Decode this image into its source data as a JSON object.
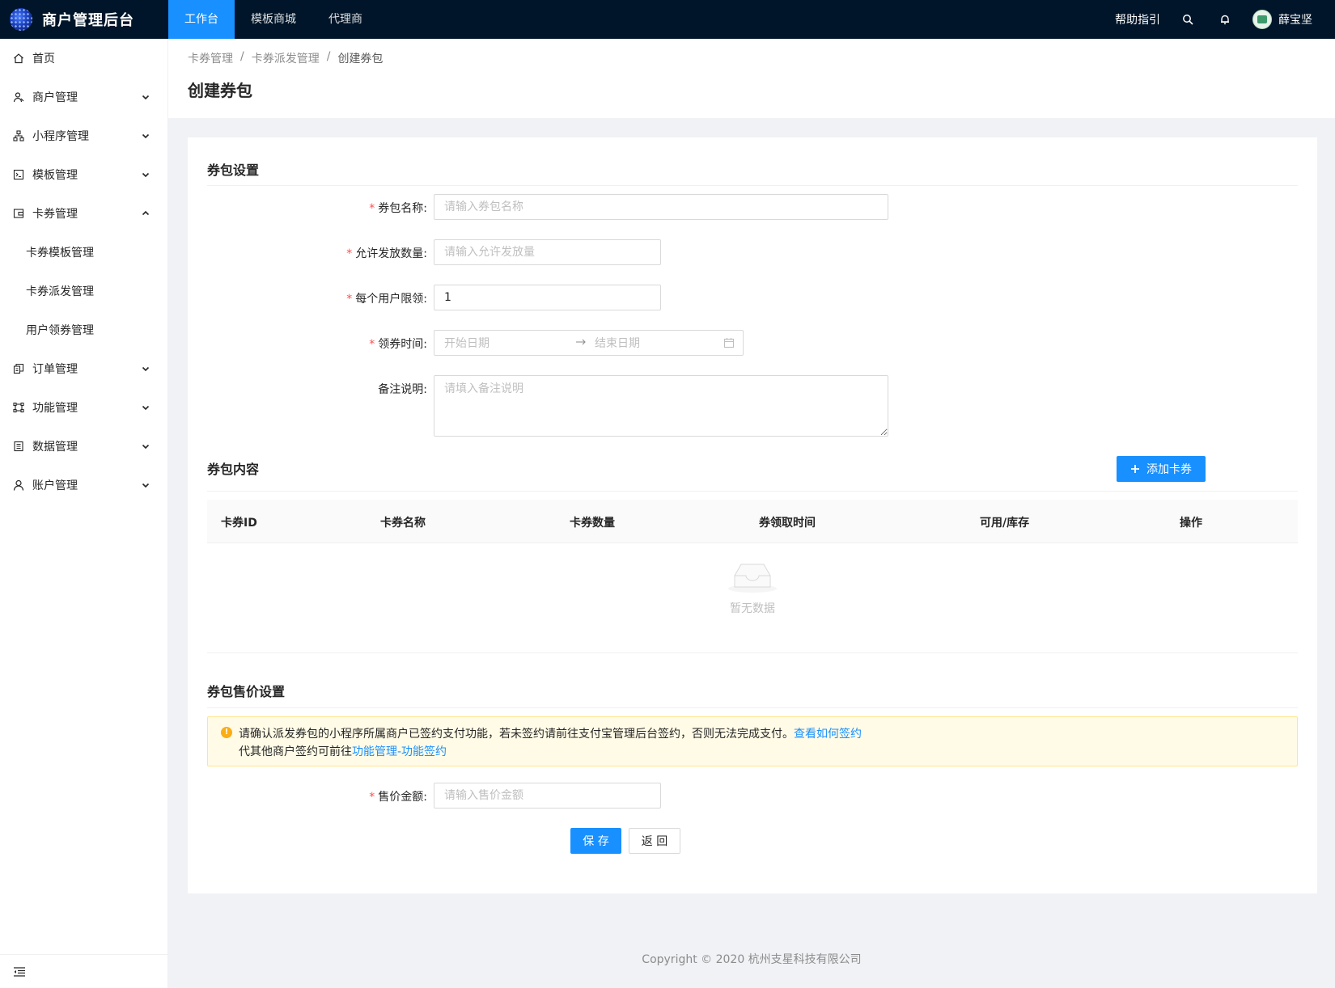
{
  "app": {
    "title": "商户管理后台"
  },
  "topnav": [
    {
      "label": "工作台",
      "active": true
    },
    {
      "label": "模板商城",
      "active": false
    },
    {
      "label": "代理商",
      "active": false
    }
  ],
  "header_right": {
    "help": "帮助指引",
    "username": "薛宝坚"
  },
  "sidebar": {
    "items": [
      {
        "label": "首页",
        "icon": "home-icon"
      },
      {
        "label": "商户管理",
        "icon": "merchant-icon",
        "expandable": true
      },
      {
        "label": "小程序管理",
        "icon": "miniprogram-icon",
        "expandable": true
      },
      {
        "label": "模板管理",
        "icon": "template-icon",
        "expandable": true
      },
      {
        "label": "卡券管理",
        "icon": "wallet-icon",
        "expanded": true
      },
      {
        "label": "订单管理",
        "icon": "order-icon",
        "expandable": true
      },
      {
        "label": "功能管理",
        "icon": "function-icon",
        "expandable": true
      },
      {
        "label": "数据管理",
        "icon": "data-icon",
        "expandable": true
      },
      {
        "label": "账户管理",
        "icon": "user-icon",
        "expandable": true
      }
    ],
    "subitems": [
      {
        "label": "卡券模板管理"
      },
      {
        "label": "卡券派发管理"
      },
      {
        "label": "用户领券管理"
      }
    ]
  },
  "breadcrumb": [
    "卡券管理",
    "卡券派发管理",
    "创建券包"
  ],
  "page_title": "创建券包",
  "sections": {
    "settings": "券包设置",
    "content": "券包内容",
    "price": "券包售价设置"
  },
  "form": {
    "name": {
      "label": "券包名称:",
      "placeholder": "请输入券包名称",
      "required": true
    },
    "quantity": {
      "label": "允许发放数量:",
      "placeholder": "请输入允许发放量",
      "required": true
    },
    "limit": {
      "label": "每个用户限领:",
      "value": "1",
      "required": true
    },
    "time": {
      "label": "领券时间:",
      "start_placeholder": "开始日期",
      "end_placeholder": "结束日期",
      "required": true
    },
    "remark": {
      "label": "备注说明:",
      "placeholder": "请填入备注说明"
    },
    "price": {
      "label": "售价金额:",
      "placeholder": "请输入售价金额",
      "required": true
    }
  },
  "add_coupon_button": "添加卡券",
  "table": {
    "columns": [
      "卡券ID",
      "卡券名称",
      "卡券数量",
      "券领取时间",
      "可用/库存",
      "操作"
    ],
    "rows": [],
    "empty_text": "暂无数据"
  },
  "alert": {
    "line1": "请确认派发券包的小程序所属商户已签约支付功能，若未签约请前往支付宝管理后台签约，否则无法完成支付。",
    "line1_link": "查看如何签约",
    "line2": "代其他商户签约可前往",
    "line2_link": "功能管理-功能签约"
  },
  "buttons": {
    "save": "保 存",
    "back": "返 回"
  },
  "footer": "Copyright © 2020 杭州支星科技有限公司",
  "colors": {
    "primary": "#1890ff",
    "topbar": "#001529",
    "required": "#ff4d4f",
    "warning": "#faad14"
  }
}
